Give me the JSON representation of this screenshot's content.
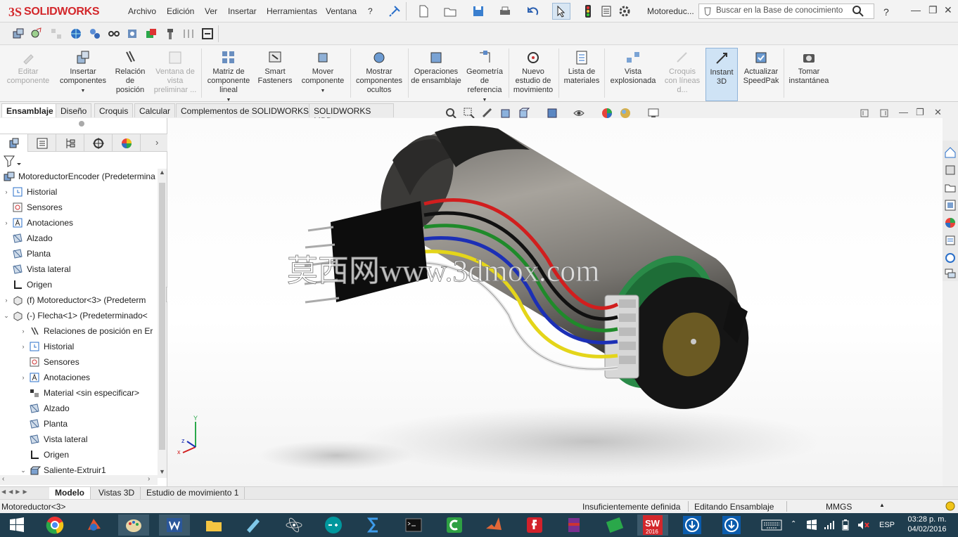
{
  "app": {
    "brand_ds": "3S",
    "brand_name": "SOLIDWORKS"
  },
  "menu": [
    "Archivo",
    "Edición",
    "Ver",
    "Insertar",
    "Herramientas",
    "Ventana",
    "?"
  ],
  "doc_title": "Motoreduc...",
  "search_placeholder": "Buscar en la Base de conocimiento",
  "help_label": "?",
  "ribbon": [
    {
      "label": "Editar componente",
      "icon": "edit-component-icon",
      "disabled": true
    },
    {
      "label": "Insertar componentes",
      "icon": "insert-components-icon",
      "disabled": false
    },
    {
      "label": "Relación de posición",
      "icon": "mate-icon",
      "disabled": false
    },
    {
      "label": "Ventana de vista preliminar ...",
      "icon": "preview-window-icon",
      "disabled": true
    },
    {
      "label": "Matriz de componente lineal",
      "icon": "linear-pattern-icon",
      "disabled": false
    },
    {
      "label": "Smart Fasteners",
      "icon": "smart-fasteners-icon",
      "disabled": false
    },
    {
      "label": "Mover componente",
      "icon": "move-component-icon",
      "disabled": false
    },
    {
      "label": "Mostrar componentes ocultos",
      "icon": "show-hidden-icon",
      "disabled": false
    },
    {
      "label": "Operaciones de ensamblaje",
      "icon": "assembly-features-icon",
      "disabled": false
    },
    {
      "label": "Geometría de referencia",
      "icon": "reference-geometry-icon",
      "disabled": false
    },
    {
      "label": "Nuevo estudio de movimiento",
      "icon": "motion-study-icon",
      "disabled": false
    },
    {
      "label": "Lista de materiales",
      "icon": "bom-icon",
      "disabled": false
    },
    {
      "label": "Vista explosionada",
      "icon": "exploded-view-icon",
      "disabled": false
    },
    {
      "label": "Croquis con líneas d...",
      "icon": "explode-sketch-icon",
      "disabled": true
    },
    {
      "label": "Instant 3D",
      "icon": "instant3d-icon",
      "disabled": false,
      "active": true
    },
    {
      "label": "Actualizar SpeedPak",
      "icon": "speedpak-icon",
      "disabled": false
    },
    {
      "label": "Tomar instantánea",
      "icon": "snapshot-icon",
      "disabled": false
    }
  ],
  "cm_tabs": [
    "Ensamblaje",
    "Diseño",
    "Croquis",
    "Calcular",
    "Complementos de SOLIDWORKS",
    "SOLIDWORKS MBD"
  ],
  "tree": {
    "root": "MotoreductorEncoder  (Predetermina",
    "nodes": [
      {
        "label": "Historial",
        "icon": "history-icon",
        "tw": "›"
      },
      {
        "label": "Sensores",
        "icon": "sensor-icon",
        "tw": ""
      },
      {
        "label": "Anotaciones",
        "icon": "annotation-icon",
        "tw": "›"
      },
      {
        "label": "Alzado",
        "icon": "plane-icon",
        "tw": ""
      },
      {
        "label": "Planta",
        "icon": "plane-icon",
        "tw": ""
      },
      {
        "label": "Vista lateral",
        "icon": "plane-icon",
        "tw": ""
      },
      {
        "label": "Origen",
        "icon": "origin-icon",
        "tw": ""
      },
      {
        "label": "(f) Motoreductor<3> (Predeterm",
        "icon": "part-icon",
        "tw": "›"
      },
      {
        "label": "(-) Flecha<1> (Predeterminado<",
        "icon": "part-icon",
        "tw": "⌄"
      },
      {
        "label": "Relaciones de posición en Er",
        "icon": "mate-icon",
        "tw": "›"
      },
      {
        "label": "Historial",
        "icon": "history-icon",
        "tw": "›"
      },
      {
        "label": "Sensores",
        "icon": "sensor-icon",
        "tw": ""
      },
      {
        "label": "Anotaciones",
        "icon": "annotation-icon",
        "tw": "›"
      },
      {
        "label": "Material <sin especificar>",
        "icon": "material-icon",
        "tw": ""
      },
      {
        "label": "Alzado",
        "icon": "plane-icon",
        "tw": ""
      },
      {
        "label": "Planta",
        "icon": "plane-icon",
        "tw": ""
      },
      {
        "label": "Vista lateral",
        "icon": "plane-icon",
        "tw": ""
      },
      {
        "label": "Origen",
        "icon": "origin-icon",
        "tw": ""
      },
      {
        "label": "Saliente-Extruir1",
        "icon": "extrude-icon",
        "tw": "⌄"
      }
    ]
  },
  "bottom_tabs": [
    "Modelo",
    "Vistas 3D",
    "Estudio de movimiento 1"
  ],
  "status": {
    "left": "Motoreductor<3>",
    "definition": "Insuficientemente definida",
    "mode": "Editando Ensamblaje",
    "units": "MMGS"
  },
  "watermark": "莫西网www.3dmox.com",
  "triad": {
    "x": "x",
    "y": "Y",
    "z": "z"
  },
  "taskbar": {
    "lang": "ESP",
    "time": "03:28 p. m.",
    "date": "04/02/2016",
    "sw_year": "2016"
  },
  "colors": {
    "accent": "#d3272b",
    "wire_red": "#d11e1e",
    "wire_green": "#1f8a2a",
    "wire_blue": "#1c2fb5",
    "wire_yellow": "#e4d51a",
    "taskbar": "#1f3d4e"
  }
}
